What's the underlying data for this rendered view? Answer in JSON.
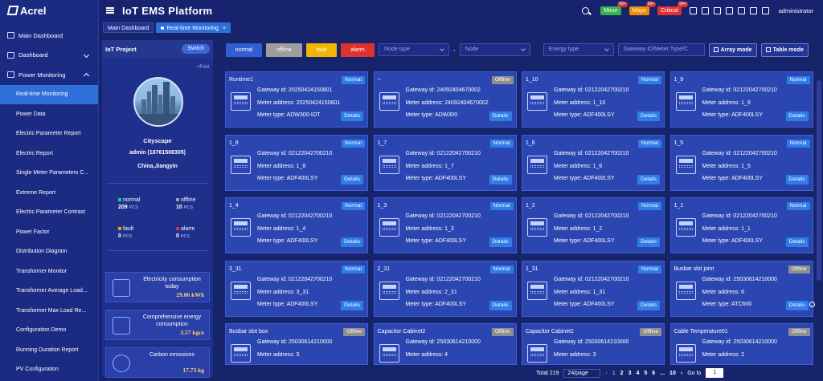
{
  "app": {
    "logo": "Acrel",
    "title": "IoT EMS Platform",
    "user": "administrator"
  },
  "alarms": [
    {
      "label": "Minor",
      "count": "99+",
      "color": "#37b24d"
    },
    {
      "label": "Major",
      "count": "99+",
      "color": "#f08c00"
    },
    {
      "label": "Critical",
      "count": "99+",
      "color": "#e03131"
    }
  ],
  "top_icons": [
    "search-icon",
    "bell-icon",
    "screen-icon",
    "fullscreen-icon",
    "grid-icon",
    "chart-icon",
    "bulb-icon",
    "shirt-icon"
  ],
  "sidebar": {
    "items": [
      {
        "label": "Main Dashboard",
        "level": 0
      },
      {
        "label": "Dashboard",
        "level": 0,
        "chevron": "down"
      },
      {
        "label": "Power Monitoring",
        "level": 0,
        "chevron": "up"
      },
      {
        "label": "Real-time Monitoring",
        "level": 1,
        "active": true
      },
      {
        "label": "Power Data",
        "level": 1
      },
      {
        "label": "Electric Parameter Report",
        "level": 1
      },
      {
        "label": "Electric Report",
        "level": 1
      },
      {
        "label": "Single Meter Parameters C...",
        "level": 1
      },
      {
        "label": "Extreme Report",
        "level": 1
      },
      {
        "label": "Electric Parameter Contrast",
        "level": 1
      },
      {
        "label": "Power Factor",
        "level": 1
      },
      {
        "label": "Distribution Diagram",
        "level": 1
      },
      {
        "label": "Transformer Monitor",
        "level": 1
      },
      {
        "label": "Transformer Average Load...",
        "level": 1
      },
      {
        "label": "Transformer Max Load Re...",
        "level": 1
      },
      {
        "label": "Configuration Demo",
        "level": 1
      },
      {
        "label": "Running Duration Report",
        "level": 1
      },
      {
        "label": "PV Configuration",
        "level": 1
      }
    ]
  },
  "tabs": [
    {
      "label": "Main Dashboard"
    },
    {
      "label": "Real-time Monitoring",
      "active": true
    }
  ],
  "project": {
    "header": "IoT Project",
    "switch_label": "Switch",
    "fold_label": "<Fold",
    "name": "Cityscape",
    "admin": "admin  (18761508305)",
    "location": "China,Jiangyin",
    "stats": [
      {
        "label": "normal",
        "value": "209",
        "unit": "PCS",
        "color": "#20c997"
      },
      {
        "label": "offline",
        "value": "10",
        "unit": "PCS",
        "color": "#9e9e9e"
      },
      {
        "label": "fault",
        "value": "0",
        "unit": "PCS",
        "color": "#f59f00"
      },
      {
        "label": "alarm",
        "value": "0",
        "unit": "PCS",
        "color": "#e03131"
      }
    ],
    "energy": [
      {
        "label": "Electricity consumption today",
        "value": "29.06 kWh",
        "icon": "meter-icon"
      },
      {
        "label": "Comprehensive energy consumption",
        "value": "3.57 kgce",
        "icon": "trend-icon"
      },
      {
        "label": "Carbon emissions",
        "value": "17.73 kg",
        "icon": "co2-cloud-icon"
      }
    ]
  },
  "filters": {
    "buttons": [
      {
        "label": "normal",
        "color": "#2f5fd0"
      },
      {
        "label": "offline",
        "color": "#9e9e9e"
      },
      {
        "label": "fault",
        "color": "#f2b600"
      },
      {
        "label": "alarm",
        "color": "#e03131"
      }
    ],
    "node_type_placeholder": "Node type",
    "dash": "-",
    "node_placeholder": "Node",
    "energy_type_placeholder": "Energy type",
    "search_placeholder": "Gateway ID/Meter Type/C",
    "array_mode": "Array mode",
    "table_mode": "Table mode"
  },
  "labels": {
    "gateway": "Gateway id:",
    "meter_address": "Meter address:",
    "meter_type": "Meter type:",
    "details": "Details"
  },
  "devices": [
    {
      "name": "Runtime1",
      "status": "Normal",
      "gateway": "20250424150801",
      "address": "20250424150801",
      "type": "ADW300-IOT"
    },
    {
      "name": "--",
      "status": "Offline",
      "gateway": "24092404670002",
      "address": "24092404670002",
      "type": "ADW300"
    },
    {
      "name": "1_10",
      "status": "Normal",
      "gateway": "02122042700210",
      "address": "1_10",
      "type": "ADF400LSY"
    },
    {
      "name": "1_9",
      "status": "Normal",
      "gateway": "02122042700210",
      "address": "1_9",
      "type": "ADF400LSY"
    },
    {
      "name": "1_8",
      "status": "Normal",
      "gateway": "02122042700210",
      "address": "1_8",
      "type": "ADF400LSY"
    },
    {
      "name": "1_7",
      "status": "Normal",
      "gateway": "02122042700210",
      "address": "1_7",
      "type": "ADF400LSY"
    },
    {
      "name": "1_6",
      "status": "Normal",
      "gateway": "02122042700210",
      "address": "1_6",
      "type": "ADF400LSY"
    },
    {
      "name": "1_5",
      "status": "Normal",
      "gateway": "02122042700210",
      "address": "1_5",
      "type": "ADF400LSY"
    },
    {
      "name": "1_4",
      "status": "Normal",
      "gateway": "02122042700210",
      "address": "1_4",
      "type": "ADF400LSY"
    },
    {
      "name": "1_3",
      "status": "Normal",
      "gateway": "02122042700210",
      "address": "1_3",
      "type": "ADF400LSY"
    },
    {
      "name": "1_2",
      "status": "Normal",
      "gateway": "02122042700210",
      "address": "1_2",
      "type": "ADF400LSY"
    },
    {
      "name": "1_1",
      "status": "Normal",
      "gateway": "02122042700210",
      "address": "1_1",
      "type": "ADF400LSY"
    },
    {
      "name": "3_31",
      "status": "Normal",
      "gateway": "02122042700210",
      "address": "3_31",
      "type": "ADF400LSY"
    },
    {
      "name": "2_31",
      "status": "Normal",
      "gateway": "02122042700210",
      "address": "2_31",
      "type": "ADF400LSY"
    },
    {
      "name": "1_31",
      "status": "Normal",
      "gateway": "02122042700210",
      "address": "1_31",
      "type": "ADF400LSY"
    },
    {
      "name": "Busbar slot joint",
      "status": "Offline",
      "gateway": "25030614210000",
      "address": "6",
      "type": "ATC600"
    },
    {
      "name": "Busbar slot box",
      "status": "Offline",
      "gateway": "25030614210000",
      "address": "5",
      "type": ""
    },
    {
      "name": "Capacitor Cabinet2",
      "status": "Offline",
      "gateway": "25030614210000",
      "address": "4",
      "type": ""
    },
    {
      "name": "Capacitor Cabinet1",
      "status": "Offline",
      "gateway": "25030614210000",
      "address": "3",
      "type": ""
    },
    {
      "name": "Cable Temperature01",
      "status": "Offline",
      "gateway": "25030614210000",
      "address": "2",
      "type": ""
    }
  ],
  "pagination": {
    "total": "Total 219",
    "page_size": "24/page",
    "pages": [
      "1",
      "2",
      "3",
      "4",
      "5",
      "6",
      "...",
      "10"
    ],
    "current": "1",
    "goto_label": "Go to",
    "goto_value": "1"
  }
}
